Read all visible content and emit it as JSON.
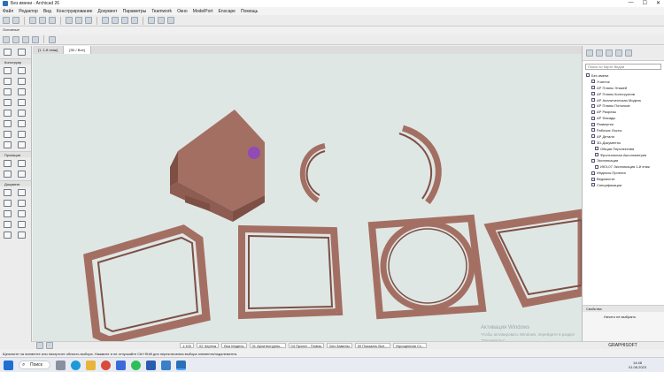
{
  "window": {
    "title": "Без имени - Archicad 26",
    "min": "—",
    "max": "☐",
    "close": "✕"
  },
  "menu": [
    "Файл",
    "Редактор",
    "Вид",
    "Конструирование",
    "Документ",
    "Параметры",
    "Teamwork",
    "Окно",
    "ModelPort",
    "Enscape",
    "Помощь"
  ],
  "info_label": "Основные",
  "toolbox": {
    "select_label": "Выбор",
    "design_label": "Конструир",
    "view_label": "Проекция",
    "document_label": "Документ"
  },
  "tabs": {
    "plan": "[1. 1-й этаж]",
    "view3d": "[3D / Все]"
  },
  "navigator": {
    "search_placeholder": "Поиск по Карте Видов",
    "root": "Без имени",
    "items": [
      "Участок",
      "АР Планы Этажей",
      "АР Планы Конструктив",
      "АР Аналитическая Модель",
      "АР Планы Потолков",
      "АР Разрезы",
      "АР Фасады",
      "Развертки",
      "Рабочие Листы",
      "АР Детали",
      "3D-Документы",
      "Общая Перспектива",
      "Фронтальная Аксонометрия",
      "Экспликации",
      "ИКЭ-07 Экспликация 1-й этаж",
      "Индексы Проекта",
      "Ведомости",
      "Спецификации"
    ]
  },
  "properties": {
    "title": "Свойства",
    "value": "Ничего не выбрано."
  },
  "status": {
    "scale": "1:100",
    "layer_combo": "02 Чертеж",
    "model": "Вся Модель",
    "arch": "01 Архитектурны...",
    "project": "04 Проект - Планы",
    "no_replace": "Без Замены",
    "show_all": "00 Показать Все...",
    "simplified": "Упрощенная Сх..."
  },
  "activation": {
    "title": "Активация Windows",
    "text": "Чтобы активировать Windows, перейдите в раздел \"Параметры\"."
  },
  "graphisoft": "GRAPHISOFT",
  "hint": "Щелкните на элементе или начертите область выбора. Нажмите и не отпускайте Ctrl+Shift для переключения выбора элемента/подэлемента.",
  "taskbar": {
    "search": "Поиск",
    "time": "14:48",
    "date": "01.08.2023"
  },
  "colors": {
    "wall": "#a46f63",
    "wall_dark": "#7d4f45",
    "wall_light": "#b88579",
    "viewport_bg": "#dfe7e5",
    "cursor": "#8a3fd1"
  }
}
